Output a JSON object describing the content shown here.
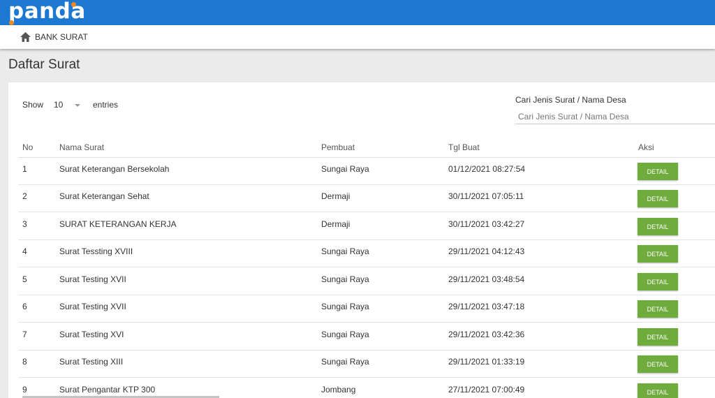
{
  "header": {
    "logo_text": "panda",
    "brand_color": "#1d78d2",
    "accent_dot_color": "#f08a1c"
  },
  "breadcrumb": {
    "icon": "home-icon",
    "label": "BANK SURAT"
  },
  "page": {
    "title": "Daftar Surat"
  },
  "controls": {
    "show_label": "Show",
    "show_value": "10",
    "entries_label": "entries",
    "search_label": "Cari Jenis Surat / Nama Desa",
    "search_placeholder": "Cari Jenis Surat / Nama Desa"
  },
  "table": {
    "columns": [
      "No",
      "Nama Surat",
      "Pembuat",
      "Tgl Buat",
      "Aksi"
    ],
    "rows": [
      {
        "no": "1",
        "nama": "Surat Keterangan Bersekolah",
        "pembuat": "Sungai Raya",
        "tgl": "01/12/2021 08:27:54",
        "aksi": "DETAIL"
      },
      {
        "no": "2",
        "nama": "Surat Keterangan Sehat",
        "pembuat": "Dermaji",
        "tgl": "30/11/2021 07:05:11",
        "aksi": "DETAIL"
      },
      {
        "no": "3",
        "nama": "SURAT KETERANGAN KERJA",
        "pembuat": "Dermaji",
        "tgl": "30/11/2021 03:42:27",
        "aksi": "DETAIL"
      },
      {
        "no": "4",
        "nama": "Surat Tessting XVIII",
        "pembuat": "Sungai Raya",
        "tgl": "29/11/2021 04:12:43",
        "aksi": "DETAIL"
      },
      {
        "no": "5",
        "nama": "Surat Testing XVII",
        "pembuat": "Sungai Raya",
        "tgl": "29/11/2021 03:48:54",
        "aksi": "DETAIL"
      },
      {
        "no": "6",
        "nama": "Surat Testing XVII",
        "pembuat": "Sungai Raya",
        "tgl": "29/11/2021 03:47:18",
        "aksi": "DETAIL"
      },
      {
        "no": "7",
        "nama": "Surat Testing XVI",
        "pembuat": "Sungai Raya",
        "tgl": "29/11/2021 03:42:36",
        "aksi": "DETAIL"
      },
      {
        "no": "8",
        "nama": "Surat Testing XIII",
        "pembuat": "Sungai Raya",
        "tgl": "29/11/2021 01:33:19",
        "aksi": "DETAIL"
      },
      {
        "no": "9",
        "nama": "Surat Pengantar KTP 300",
        "pembuat": "Jombang",
        "tgl": "27/11/2021 07:00:49",
        "aksi": "DETAIL"
      }
    ]
  }
}
